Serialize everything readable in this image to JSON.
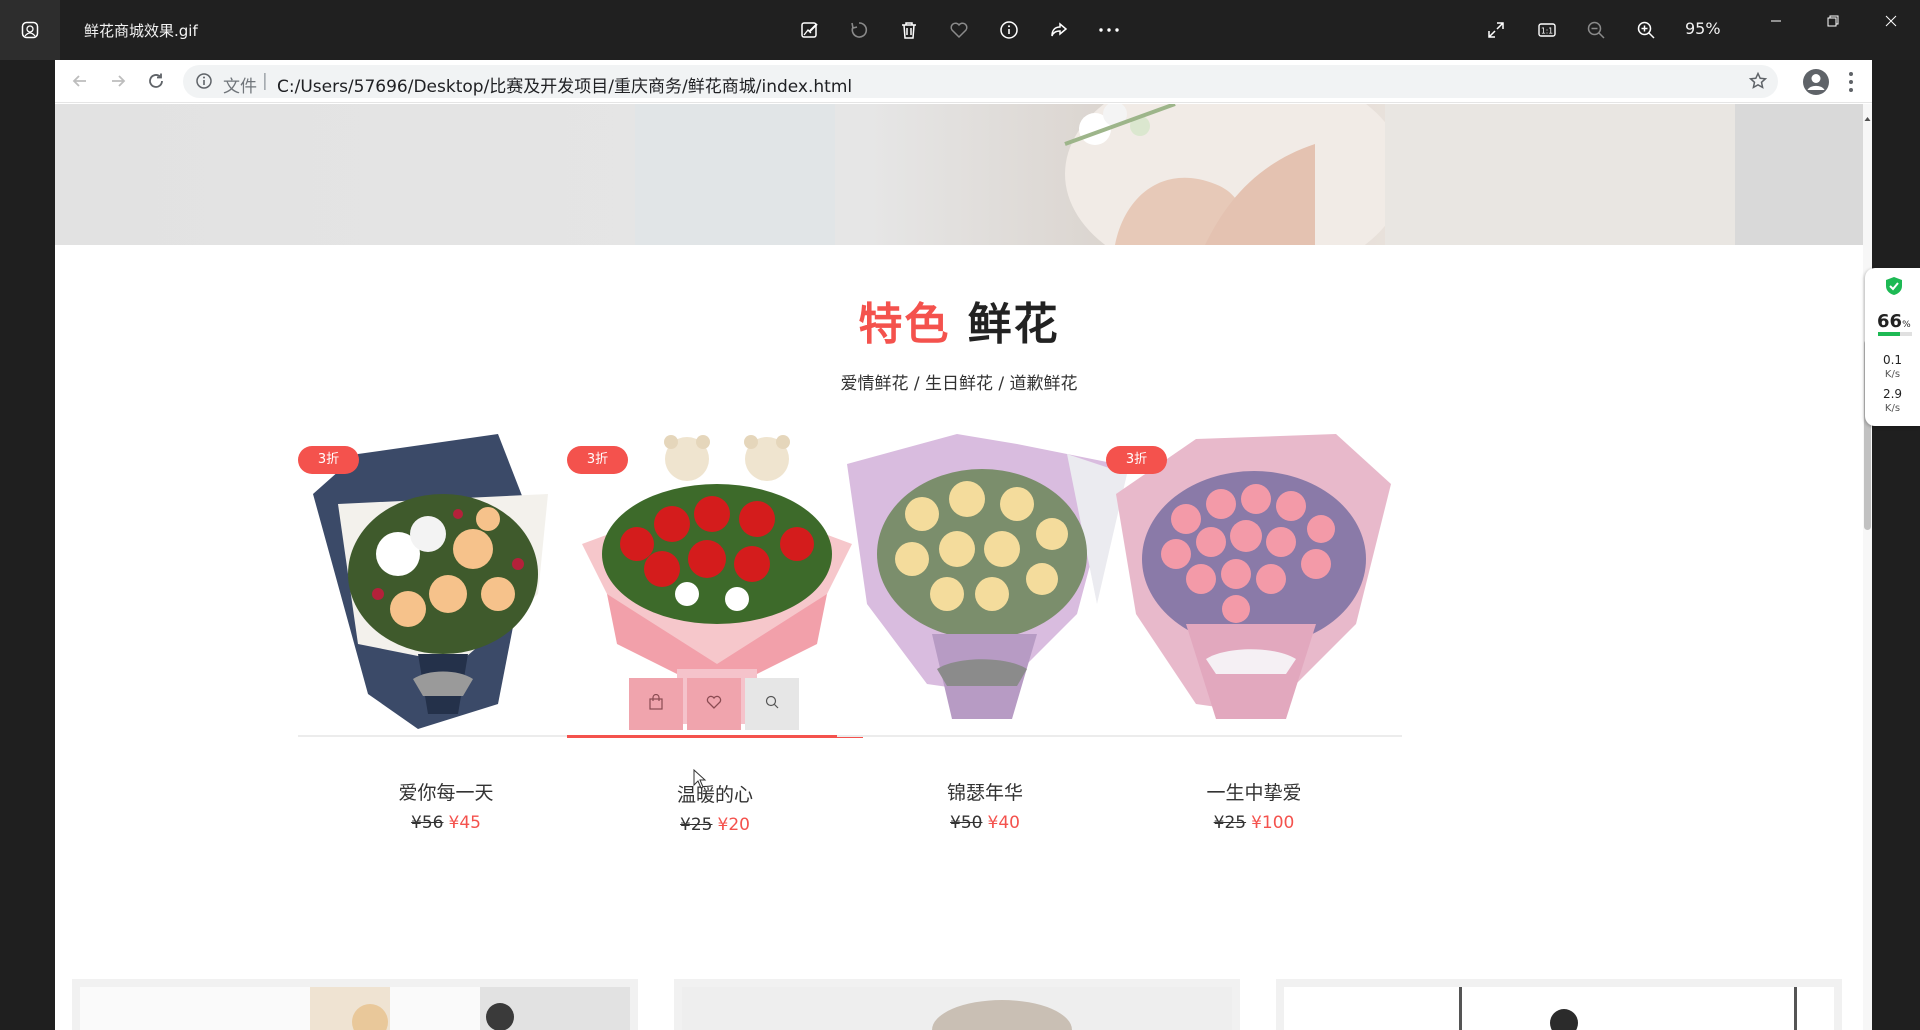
{
  "viewer": {
    "file_name": "鲜花商城效果.gif",
    "zoom": "95%",
    "toolbar_icons": [
      "edit-image-icon",
      "rotate-icon",
      "delete-icon",
      "favorite-icon",
      "info-icon",
      "share-icon",
      "more-icon"
    ],
    "right_icons": [
      "fullscreen-icon",
      "actual-size-icon",
      "zoom-out-icon",
      "zoom-in-icon"
    ]
  },
  "browser": {
    "url_scheme_label": "文件",
    "url": "C:/Users/57696/Desktop/比赛及开发项目/重庆商务/鲜花商城/index.html"
  },
  "section": {
    "title_highlight": "特色",
    "title_rest": "鲜花",
    "subtitle": "爱情鲜花 / 生日鲜花 / 道歉鲜花"
  },
  "products": [
    {
      "name": "爱你每一天",
      "old_price": "¥56",
      "new_price": "¥45",
      "badge": "3折",
      "flower_color": "#f6c28b"
    },
    {
      "name": "温暖的心",
      "old_price": "¥25",
      "new_price": "¥20",
      "badge": "3折",
      "flower_color": "#d41c1c"
    },
    {
      "name": "锦瑟年华",
      "old_price": "¥50",
      "new_price": "¥40",
      "badge": "",
      "flower_color": "#f4dc9c"
    },
    {
      "name": "一生中挚爱",
      "old_price": "¥25",
      "new_price": "¥100",
      "badge": "3折",
      "flower_color": "#f39aa8"
    }
  ],
  "accent_color": "#f4524d",
  "net_monitor": {
    "percent": "66",
    "percent_unit": "%",
    "upload": "0.1",
    "download": "2.9",
    "unit": "K/s",
    "usage_fraction": 0.66
  }
}
